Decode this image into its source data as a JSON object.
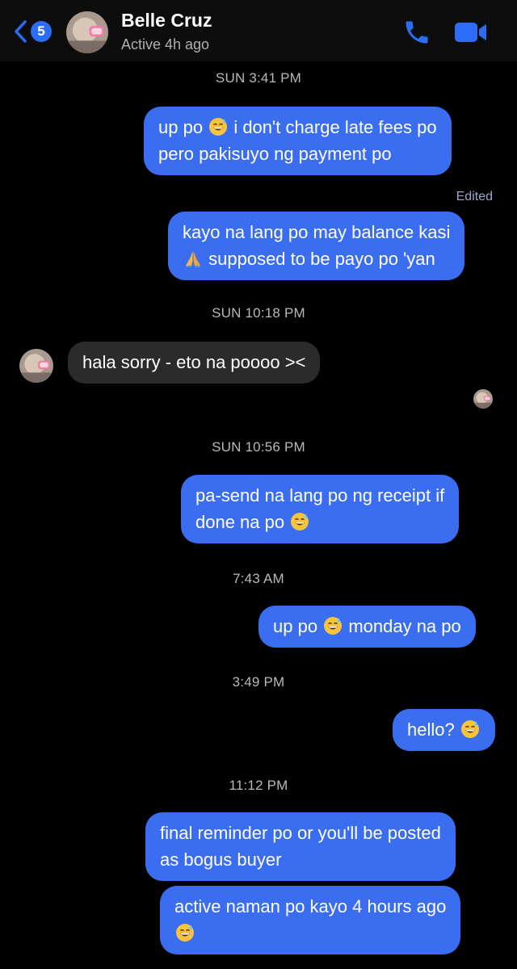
{
  "header": {
    "back_count": "5",
    "contact_name": "Belle Cruz",
    "status": "Active 4h ago"
  },
  "timestamps": [
    "SUN 3:41 PM",
    "SUN 10:18 PM",
    "SUN 10:56 PM",
    "7:43 AM",
    "3:49 PM",
    "11:12 PM"
  ],
  "edited_label": "Edited",
  "messages": [
    {
      "from": "me",
      "lines": [
        "up po",
        "i don't charge late fees po",
        "pero pakisuyo ng payment po"
      ]
    },
    {
      "from": "me",
      "lines": [
        "kayo na lang po may balance kasi",
        "supposed to be payo po 'yan"
      ]
    },
    {
      "from": "them",
      "lines": [
        "hala sorry - eto na poooo ><"
      ]
    },
    {
      "from": "me",
      "lines": [
        "pa-send na lang po ng receipt if",
        "done na po"
      ]
    },
    {
      "from": "me",
      "lines": [
        "up po",
        "monday na po"
      ]
    },
    {
      "from": "me",
      "lines": [
        "hello?"
      ]
    },
    {
      "from": "me",
      "lines": [
        "final reminder po or you'll be posted",
        "as bogus buyer"
      ]
    },
    {
      "from": "me",
      "lines": [
        "active naman po kayo 4 hours ago"
      ]
    }
  ],
  "icons": {
    "back": "chevron-left-icon",
    "call": "phone-icon",
    "video": "video-camera-icon",
    "emoji_sweat": "grinning-sweat-emoji",
    "emoji_pray": "folded-hands-emoji"
  },
  "colors": {
    "outgoing_bubble": "#3a6df0",
    "incoming_bubble": "#2b2b2b",
    "accent": "#2d6cf6",
    "background": "#000000"
  }
}
